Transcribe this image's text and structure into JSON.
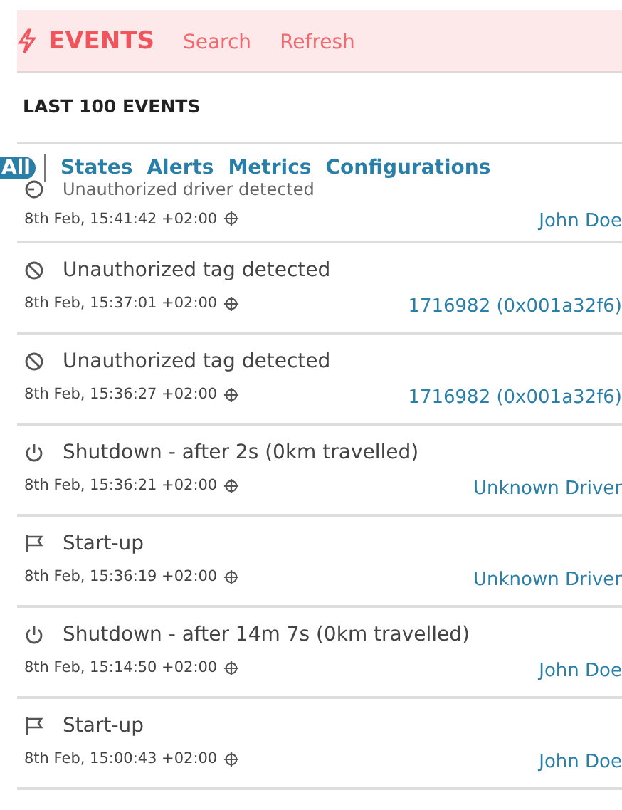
{
  "header": {
    "title": "EVENTS",
    "actions": [
      "Search",
      "Refresh"
    ]
  },
  "section_title": "LAST 100 EVENTS",
  "tabs": [
    {
      "label": "All",
      "selected": true
    },
    {
      "label": "States",
      "selected": false
    },
    {
      "label": "Alerts",
      "selected": false
    },
    {
      "label": "Metrics",
      "selected": false
    },
    {
      "label": "Configurations",
      "selected": false
    }
  ],
  "events": [
    {
      "kind": "driver",
      "title": "Unauthorized driver detected",
      "time": "8th Feb, 15:41:42 +02:00",
      "subject": "John Doe"
    },
    {
      "kind": "tag",
      "title": "Unauthorized tag detected",
      "time": "8th Feb, 15:37:01 +02:00",
      "subject": "1716982 (0x001a32f6)"
    },
    {
      "kind": "tag",
      "title": "Unauthorized tag detected",
      "time": "8th Feb, 15:36:27 +02:00",
      "subject": "1716982 (0x001a32f6)"
    },
    {
      "kind": "shutdown",
      "title": "Shutdown - after 2s (0km travelled)",
      "time": "8th Feb, 15:36:21 +02:00",
      "subject": "Unknown Driver"
    },
    {
      "kind": "startup",
      "title": "Start-up",
      "time": "8th Feb, 15:36:19 +02:00",
      "subject": "Unknown Driver"
    },
    {
      "kind": "shutdown",
      "title": "Shutdown - after 14m 7s (0km travelled)",
      "time": "8th Feb, 15:14:50 +02:00",
      "subject": "John Doe"
    },
    {
      "kind": "startup",
      "title": "Start-up",
      "time": "8th Feb, 15:00:43 +02:00",
      "subject": "John Doe"
    }
  ]
}
